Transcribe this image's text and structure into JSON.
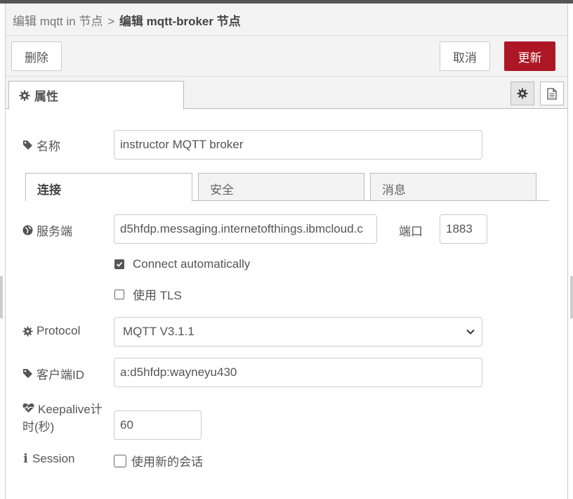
{
  "breadcrumb": {
    "parent": "编辑 mqtt in 节点",
    "separator": ">",
    "current": "编辑 mqtt-broker 节点"
  },
  "buttons": {
    "delete": "删除",
    "cancel": "取消",
    "update": "更新",
    "update_color": "#ad1625"
  },
  "tabs": {
    "properties": "属性"
  },
  "form": {
    "name": {
      "label": "名称",
      "value": "instructor MQTT broker",
      "icon": "tag-icon"
    },
    "server": {
      "label": "服务端",
      "value": "d5hfdp.messaging.internetofthings.ibmcloud.c",
      "icon": "globe-icon"
    },
    "port": {
      "label": "端口",
      "value": "1883"
    },
    "connect_auto": {
      "label": "Connect automatically",
      "checked": true
    },
    "use_tls": {
      "label": "使用 TLS",
      "checked": false
    },
    "protocol": {
      "label": "Protocol",
      "value": "MQTT V3.1.1",
      "icon": "gear-icon"
    },
    "client_id": {
      "label": "客户端ID",
      "value": "a:d5hfdp:wayneyu430",
      "icon": "tag-icon"
    },
    "keepalive": {
      "label_line1": "Keepalive计",
      "label_line2": "时(秒)",
      "value": "60",
      "icon": "heartbeat-icon"
    },
    "session": {
      "label": "Session",
      "checkbox_label": "使用新的会话",
      "checked": false,
      "icon": "info-icon"
    }
  },
  "inner_tabs": [
    "连接",
    "安全",
    "消息"
  ]
}
